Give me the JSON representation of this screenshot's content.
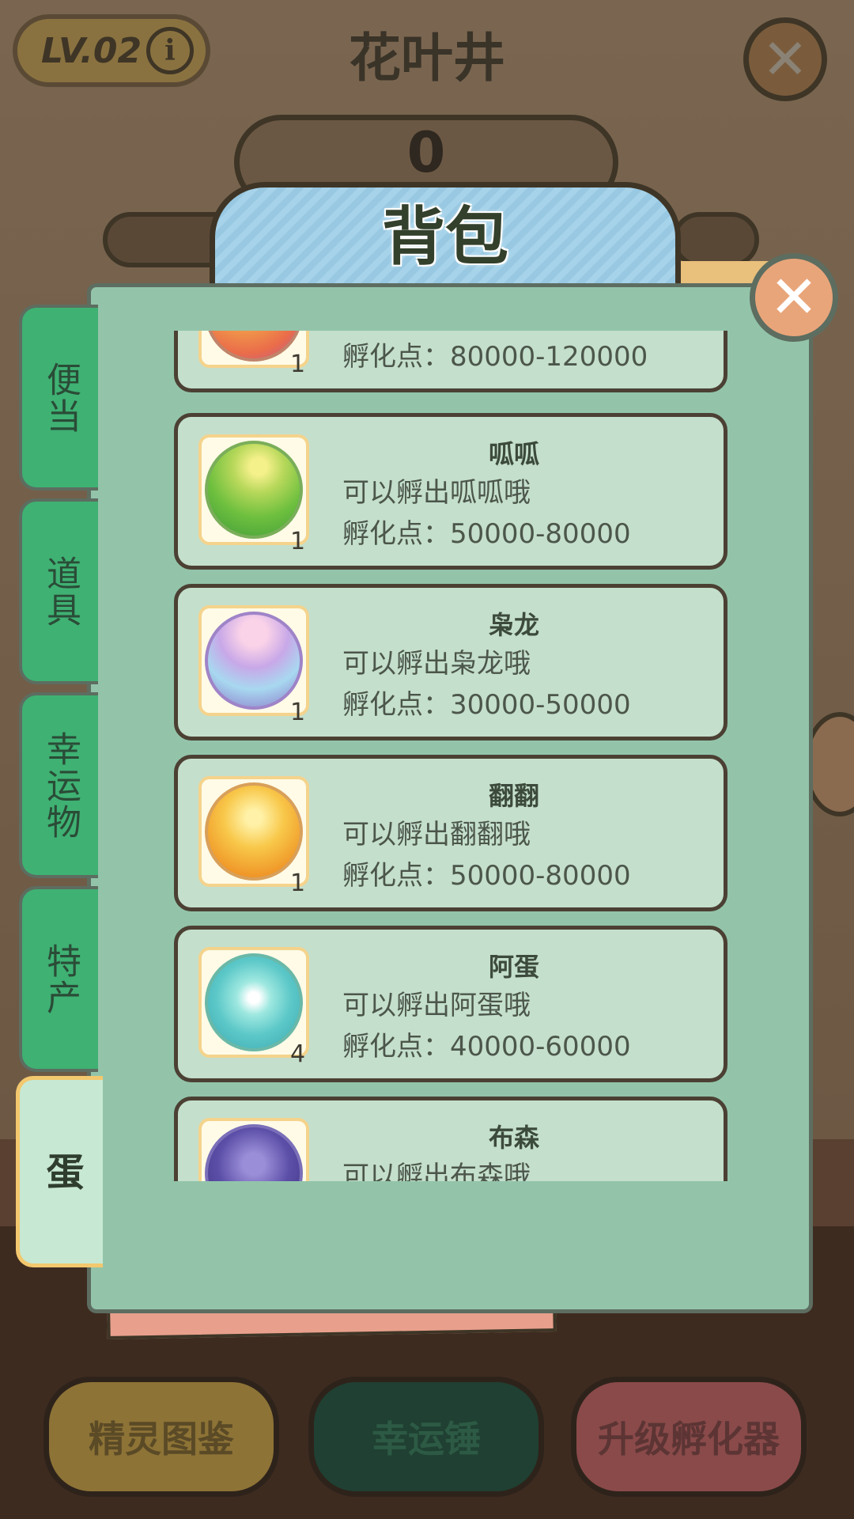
{
  "header": {
    "level": "LV.02",
    "title": "花叶井",
    "score": "0"
  },
  "backpack": {
    "title": "背包"
  },
  "tabs": [
    {
      "label": "便当"
    },
    {
      "label": "道具"
    },
    {
      "label": "幸运物"
    },
    {
      "label": "特产"
    },
    {
      "label": "蛋",
      "active": true
    }
  ],
  "items": [
    {
      "name": "",
      "desc": "",
      "points": "孵化点：80000-120000",
      "count": "1"
    },
    {
      "name": "呱呱",
      "desc": "可以孵出呱呱哦",
      "points": "孵化点：50000-80000",
      "count": "1"
    },
    {
      "name": "枭龙",
      "desc": "可以孵出枭龙哦",
      "points": "孵化点：30000-50000",
      "count": "1"
    },
    {
      "name": "翻翻",
      "desc": "可以孵出翻翻哦",
      "points": "孵化点：50000-80000",
      "count": "1"
    },
    {
      "name": "阿蛋",
      "desc": "可以孵出阿蛋哦",
      "points": "孵化点：40000-60000",
      "count": "4"
    },
    {
      "name": "布森",
      "desc": "可以孵出布森哦",
      "points": "",
      "count": ""
    }
  ],
  "bottom_buttons": [
    {
      "label": "精灵图鉴"
    },
    {
      "label": "幸运锤"
    },
    {
      "label": "升级孵化器"
    }
  ],
  "icons": {
    "info": "info-icon",
    "close": "close-icon"
  }
}
